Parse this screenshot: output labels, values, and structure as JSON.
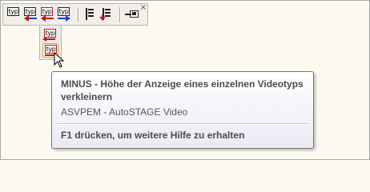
{
  "toolbar": {
    "buttons": [
      {
        "label": "typ",
        "name": "typ-button"
      },
      {
        "label": "typ",
        "name": "typ-blue-arrow-left-button"
      },
      {
        "label": "typ",
        "name": "typ-red-arrow-button"
      },
      {
        "label": "typ",
        "name": "typ-blue-arrow-right-button"
      }
    ],
    "close_glyph": "×"
  },
  "dropdown": {
    "items": [
      {
        "label": "typ",
        "name": "plus-typ-item"
      },
      {
        "label": "typ",
        "name": "minus-typ-item"
      }
    ]
  },
  "tooltip": {
    "title": "MINUS - Höhe der Anzeige eines einzelnen Videotyps verkleinern",
    "subtitle": "ASVPEM - AutoSTAGE Video",
    "help": "F1 drücken, um weitere Hilfe zu erhalten"
  },
  "colors": {
    "accent_red": "#c0151a",
    "accent_blue": "#2a3bd0",
    "hover_border": "#d0a24a",
    "background": "#fdfaf0"
  }
}
